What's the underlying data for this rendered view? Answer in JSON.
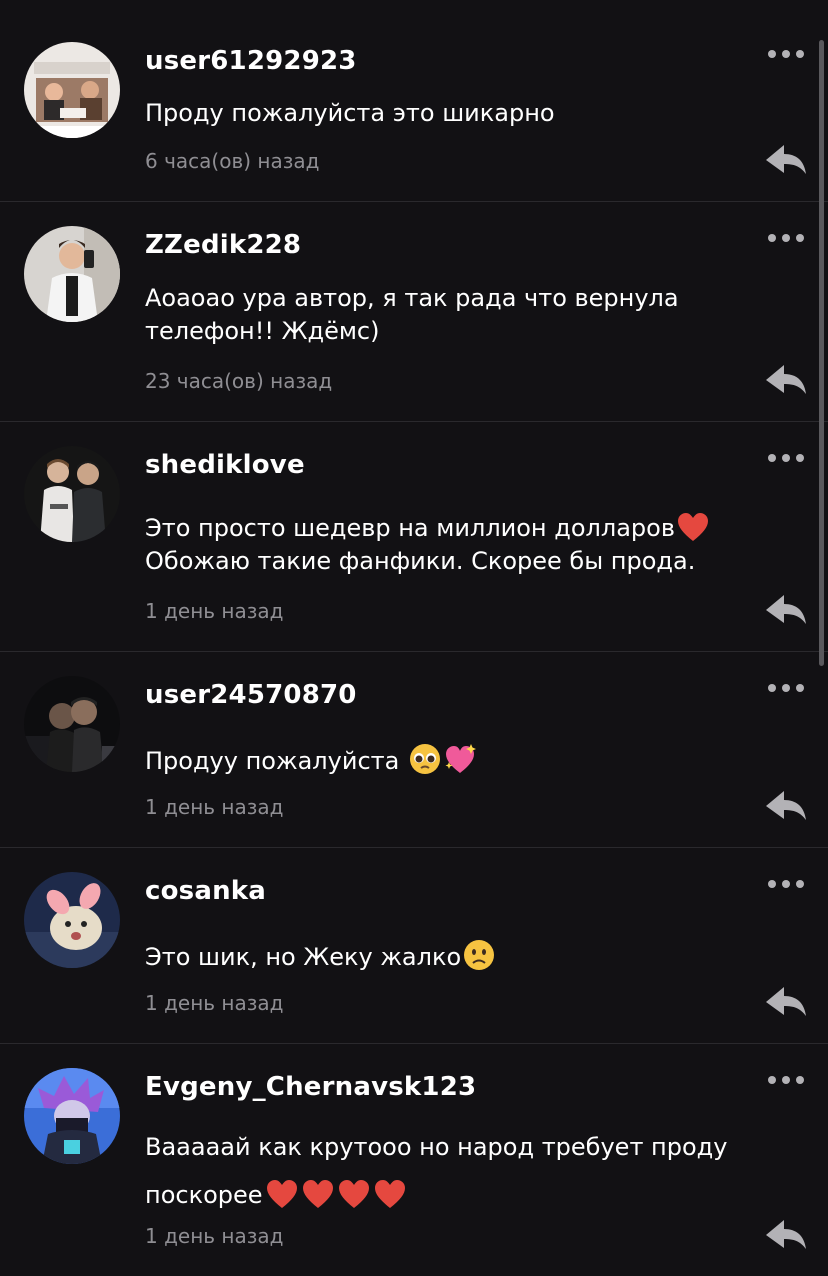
{
  "comments": [
    {
      "username": "user61292923",
      "text": "Проду пожалуйста это шикарно",
      "time": "6 часа(ов) назад",
      "avatar_icon": "avatar-photo-people-table-icon"
    },
    {
      "username": "ZZedik228",
      "text": "Аоаоао ура автор, я так рада что вернула телефон!! Ждёмс)",
      "time": "23 часа(ов) назад",
      "avatar_icon": "avatar-photo-mirror-selfie-icon"
    },
    {
      "username": "shediklove",
      "text_line1": "Это просто шедевр на миллион долларов",
      "text_line2": "Обожаю такие фанфики. Скорее бы прода.",
      "emoji": "red-heart-emoji",
      "time": "1 день назад",
      "avatar_icon": "avatar-photo-two-boys-icon"
    },
    {
      "username": "user24570870",
      "text": "Продуу пожалуйста",
      "emoji": [
        "pleading-face-emoji",
        "sparkling-heart-emoji"
      ],
      "time": "1 день назад",
      "avatar_icon": "avatar-photo-couple-night-icon"
    },
    {
      "username": "cosanka",
      "text": "Это шик, но Жеку жалко",
      "emoji": "slightly-frowning-face-emoji",
      "time": "1 день назад",
      "avatar_icon": "avatar-photo-cat-bunny-ears-icon"
    },
    {
      "username": "Evgeny_Chernavsk123",
      "text_line1": "Вааааай как крутооо но народ требует проду",
      "text_line2": "поскорее",
      "emoji": [
        "red-heart-emoji",
        "red-heart-emoji",
        "red-heart-emoji",
        "red-heart-emoji"
      ],
      "time": "1 день назад",
      "avatar_icon": "avatar-anime-purple-hair-icon"
    }
  ],
  "icons": {
    "more": "more-dots-icon",
    "reply": "reply-arrow-icon"
  },
  "colors": {
    "background": "#121114",
    "username": "#ffffff",
    "text": "#ffffff",
    "time": "#8f8e93",
    "icon": "#b3b2b6",
    "divider": "#2a292d"
  }
}
